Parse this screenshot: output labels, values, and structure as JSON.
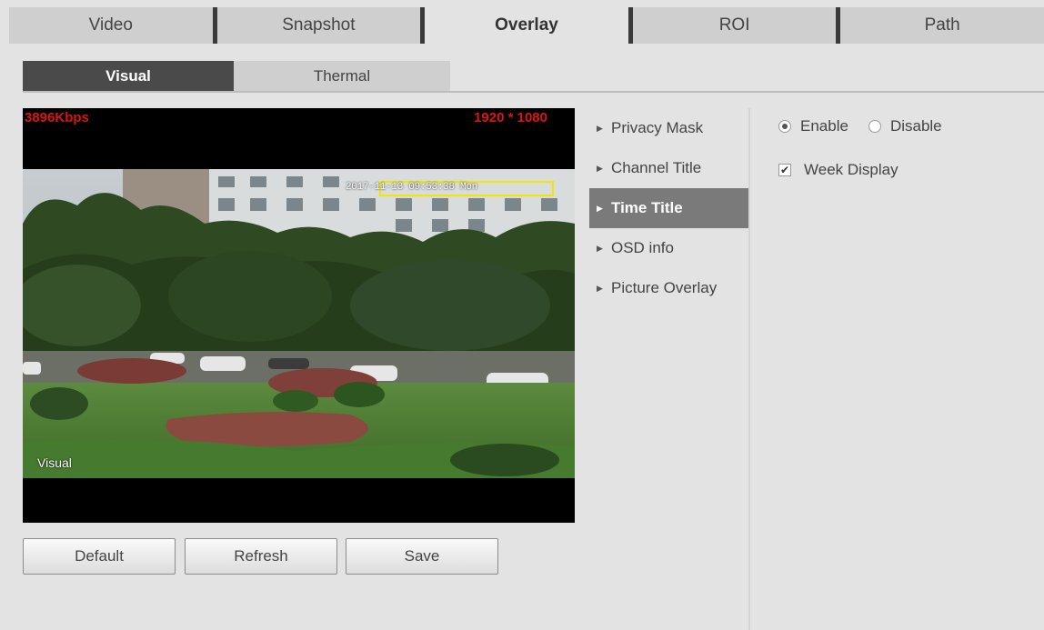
{
  "top_tabs": [
    {
      "label": "Video",
      "active": false
    },
    {
      "label": "Snapshot",
      "active": false
    },
    {
      "label": "Overlay",
      "active": true
    },
    {
      "label": "ROI",
      "active": false
    },
    {
      "label": "Path",
      "active": false
    }
  ],
  "sub_tabs": [
    {
      "label": "Visual",
      "active": true
    },
    {
      "label": "Thermal",
      "active": false
    }
  ],
  "video": {
    "bitrate": "3896Kbps",
    "resolution": "1920 * 1080",
    "time_osd": "2017-11-13 09:53:38 Mon",
    "channel_name": "Visual"
  },
  "buttons": {
    "default": "Default",
    "refresh": "Refresh",
    "save": "Save"
  },
  "menu": [
    {
      "label": "Privacy Mask",
      "active": false
    },
    {
      "label": "Channel Title",
      "active": false
    },
    {
      "label": "Time Title",
      "active": true
    },
    {
      "label": "OSD info",
      "active": false
    },
    {
      "label": "Picture Overlay",
      "active": false
    }
  ],
  "options": {
    "enable_label": "Enable",
    "disable_label": "Disable",
    "enable_selected": true,
    "week_display_label": "Week Display",
    "week_display_checked": true,
    "check_glyph": "✔"
  },
  "icons": {
    "menu_arrow": "▶"
  }
}
